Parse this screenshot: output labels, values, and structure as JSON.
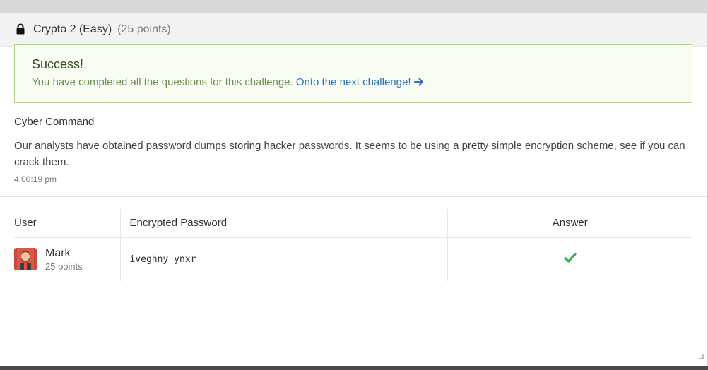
{
  "header": {
    "title": "Crypto 2 (Easy)",
    "points": "(25 points)"
  },
  "alert": {
    "title": "Success!",
    "message": "You have completed all the questions for this challenge.",
    "link": "Onto the next challenge!"
  },
  "challenge": {
    "source": "Cyber Command",
    "description": "Our analysts have obtained password dumps storing hacker passwords. It seems to be using a pretty simple encryption scheme, see if you can crack them.",
    "time": "4:00:19 pm"
  },
  "table": {
    "headers": {
      "user": "User",
      "encrypted": "Encrypted Password",
      "answer": "Answer"
    },
    "rows": [
      {
        "user_name": "Mark",
        "user_points": "25 points",
        "encrypted": "iveghny ynxr",
        "answer_icon": "checkmark-icon"
      }
    ]
  },
  "colors": {
    "success_green": "#2eb34a",
    "link_blue": "#2f6fb3",
    "alert_border": "#b6d38f"
  }
}
